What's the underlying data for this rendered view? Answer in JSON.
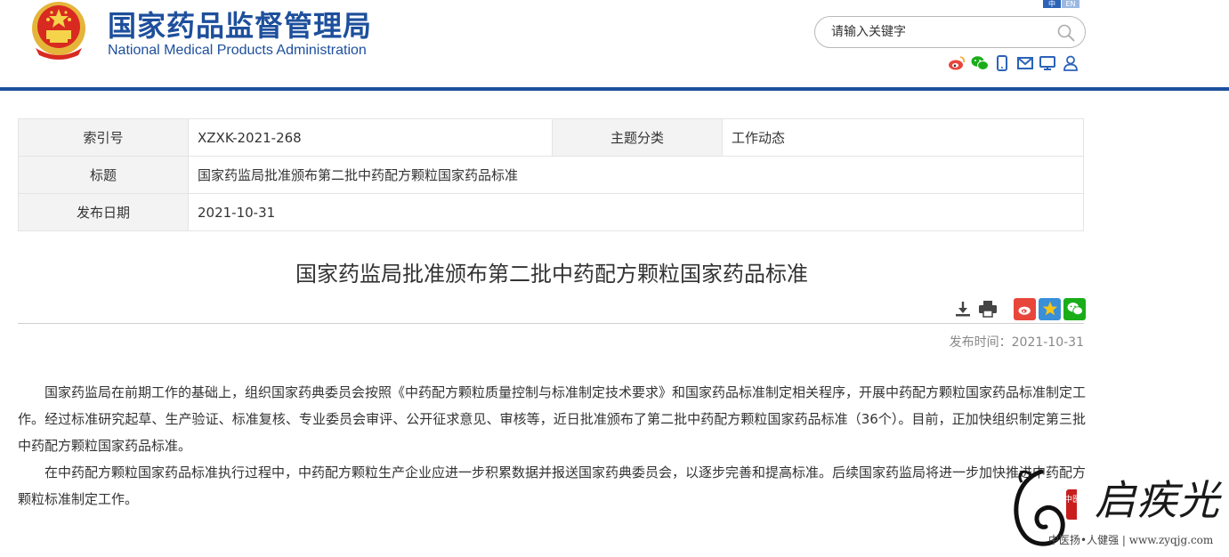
{
  "header": {
    "site_name_cn": "国家药品监督管理局",
    "site_name_en": "National Medical Products Administration",
    "lang_zh": "中",
    "lang_en": "EN",
    "search_placeholder": "请输入关键字"
  },
  "info": {
    "rows": [
      {
        "label": "索引号",
        "value": "XZXK-2021-268",
        "label2": "主题分类",
        "value2": "工作动态"
      },
      {
        "label": "标题",
        "value": "国家药监局批准颁布第二批中药配方颗粒国家药品标准"
      },
      {
        "label": "发布日期",
        "value": "2021-10-31"
      }
    ]
  },
  "article": {
    "title": "国家药监局批准颁布第二批中药配方颗粒国家药品标准",
    "publish_time": "发布时间：2021-10-31",
    "paragraphs": [
      "国家药监局在前期工作的基础上，组织国家药典委员会按照《中药配方颗粒质量控制与标准制定技术要求》和国家药品标准制定相关程序，开展中药配方颗粒国家药品标准制定工作。经过标准研究起草、生产验证、标准复核、专业委员会审评、公开征求意见、审核等，近日批准颁布了第二批中药配方颗粒国家药品标准（36个）。目前，正加快组织制定第三批中药配方颗粒国家药品标准。",
      "在中药配方颗粒国家药品标准执行过程中，中药配方颗粒生产企业应进一步积累数据并报送国家药典委员会，以逐步完善和提高标准。后续国家药监局将进一步加快推进中药配方颗粒标准制定工作。"
    ]
  },
  "watermark": {
    "brand": "启疾光",
    "slogan": "中医扬•人健强 | www.zyqjg.com",
    "seal_text": "中医"
  },
  "colors": {
    "brand_blue": "#1d4f9c",
    "weibo_red": "#e8463b",
    "wechat_green": "#1aad19"
  }
}
